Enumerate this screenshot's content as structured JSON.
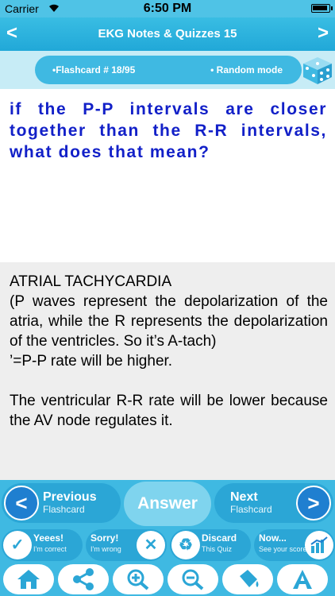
{
  "status_bar": {
    "carrier": "Carrier",
    "time": "6:50 PM"
  },
  "nav": {
    "title": "EKG Notes & Quizzes 15",
    "back_glyph": "<",
    "forward_glyph": ">"
  },
  "card_info": {
    "flashcard_label": "•Flashcard #  18/95",
    "mode_label": "• Random mode"
  },
  "question": "if the P-P intervals are closer together than the R-R intervals, what does that mean?",
  "answer": {
    "lines": [
      "ATRIAL TACHYCARDIA",
      "(P waves represent the depolarization of the atria, while the R represents the depolarization of the ventricles. So it’s A-tach)",
      "’=P-P rate will be higher.",
      "",
      "The ventricular R-R rate will be lower because the AV node regulates it."
    ]
  },
  "controls": {
    "previous": {
      "big": "Previous",
      "small": "Flashcard"
    },
    "answer": "Answer",
    "next": {
      "big": "Next",
      "small": "Flashcard"
    },
    "correct": {
      "big": "Yeees!",
      "small": "I'm correct"
    },
    "wrong": {
      "big": "Sorry!",
      "small": "I'm wrong"
    },
    "discard": {
      "big": "Discard",
      "small": "This Quiz"
    },
    "score": {
      "big": "Now...",
      "small": "See your score"
    }
  },
  "toolbar": {
    "icons": [
      "home-icon",
      "share-icon",
      "zoom-in-icon",
      "zoom-out-icon",
      "bucket-icon",
      "text-icon"
    ]
  },
  "colors": {
    "accent": "#3fb9e2",
    "question_text": "#1220c8",
    "answer_bg": "#eeeeee"
  }
}
